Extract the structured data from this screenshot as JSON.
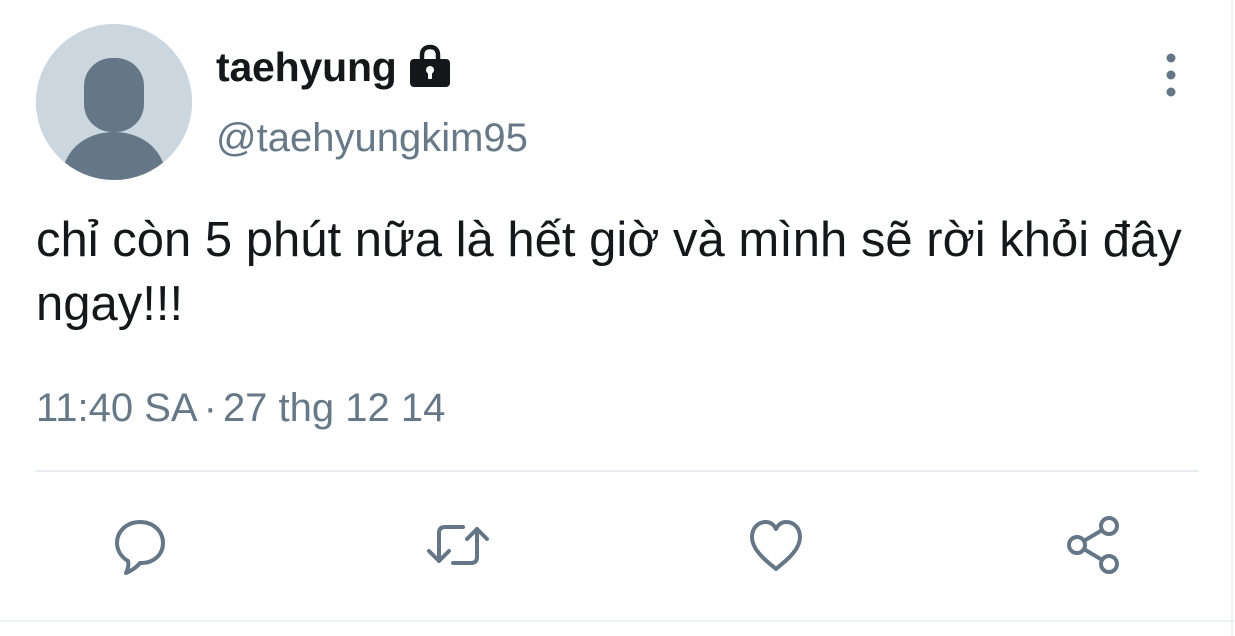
{
  "author": {
    "display_name": "taehyung",
    "handle": "@taehyungkim95",
    "protected_icon": "lock-icon",
    "avatar_icon": "default-profile-avatar"
  },
  "tweet": {
    "text": "chỉ còn 5 phút nữa là hết giờ và mình sẽ rời khỏi đây ngay!!!",
    "time": "11:40 SA",
    "separator": "·",
    "date": "27 thg 12 14"
  },
  "actions": [
    {
      "name": "reply",
      "icon": "reply-icon"
    },
    {
      "name": "retweet",
      "icon": "retweet-icon"
    },
    {
      "name": "like",
      "icon": "heart-icon"
    },
    {
      "name": "share",
      "icon": "share-icon"
    }
  ],
  "menu": {
    "icon": "more-vertical-icon"
  },
  "colors": {
    "text_primary": "#15181b",
    "text_secondary": "#677886",
    "icon": "#657786",
    "avatar_bg": "#cbd6df",
    "avatar_fg": "#657786",
    "divider": "#e6ecf0"
  }
}
